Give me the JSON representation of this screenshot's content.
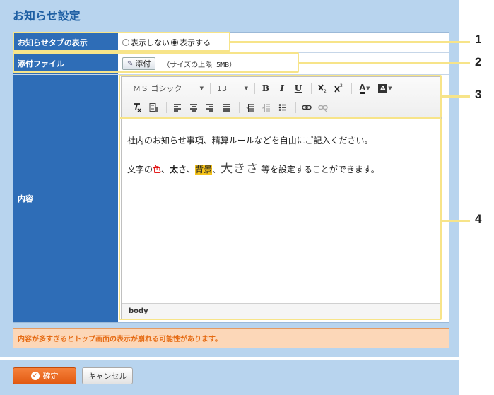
{
  "page": {
    "title": "お知らせ設定"
  },
  "form": {
    "tab_display": {
      "label": "お知らせタブの表示",
      "options": [
        "表示しない",
        "表示する"
      ],
      "selected": "表示する"
    },
    "attachment": {
      "label": "添付ファイル",
      "button_label": "添付",
      "note": "（サイズの上限 5MB）"
    },
    "content": {
      "label": "内容"
    }
  },
  "editor": {
    "font_name": "ＭＳ ゴシック",
    "font_size": "13",
    "buttons": {
      "bold": "B",
      "italic": "I",
      "underline": "U",
      "text_color": "A",
      "bg_color": "A"
    },
    "body": {
      "line1": "社内のお知らせ事項、精算ルールなどを自由にご記入ください。",
      "line2_prefix": "文字の",
      "line2_color": "色",
      "line2_sep1": "、",
      "line2_bold": "太さ",
      "line2_sep2": "、",
      "line2_bg": "背景",
      "line2_sep3": "、",
      "line2_size": "大きさ",
      "line2_suffix": " 等を設定することができます。"
    },
    "status_path": "body"
  },
  "warning": "内容が多すぎるとトップ画面の表示が崩れる可能性があります。",
  "actions": {
    "confirm_label": "確定",
    "cancel_label": "キャンセル"
  },
  "callouts": [
    "1",
    "2",
    "3",
    "4"
  ],
  "colors": {
    "panel_bg": "#b8d4ee",
    "label_bg": "#2e6db7",
    "title": "#1e5fa3",
    "callout": "#f7e489",
    "confirm": "#e86b1f",
    "warning_text": "#e56a12",
    "warning_bg": "#fcd7b8"
  }
}
